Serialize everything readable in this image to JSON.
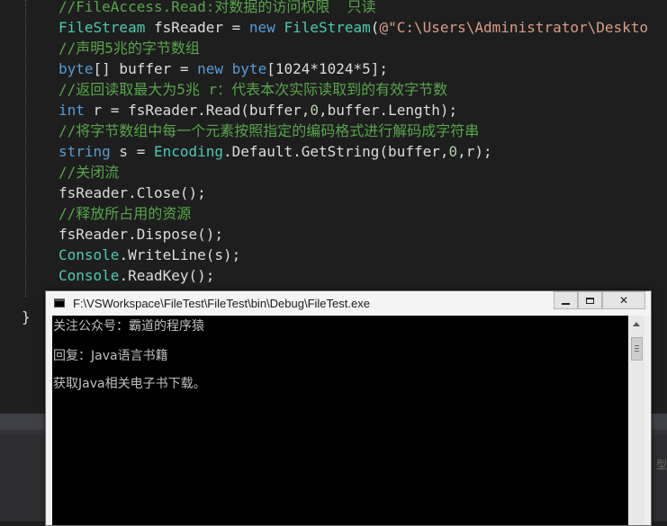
{
  "editor": {
    "lines": [
      [
        {
          "t": "//FileAccess.Read:对数据的访问权限  只读",
          "c": "cm"
        }
      ],
      [
        {
          "t": "FileStream",
          "c": "ty"
        },
        {
          "t": " fsReader = ",
          "c": ""
        },
        {
          "t": "new",
          "c": "kw"
        },
        {
          "t": " ",
          "c": ""
        },
        {
          "t": "FileStream",
          "c": "ty"
        },
        {
          "t": "(",
          "c": ""
        },
        {
          "t": "@\"C:\\Users\\Administrator\\Deskto",
          "c": "str"
        }
      ],
      [
        {
          "t": "//声明5兆的字节数组",
          "c": "cm"
        }
      ],
      [
        {
          "t": "byte",
          "c": "kw"
        },
        {
          "t": "[] buffer = ",
          "c": ""
        },
        {
          "t": "new",
          "c": "kw"
        },
        {
          "t": " ",
          "c": ""
        },
        {
          "t": "byte",
          "c": "kw"
        },
        {
          "t": "[1024*1024*5];",
          "c": ""
        }
      ],
      [
        {
          "t": "//返回读取最大为5兆 r：代表本次实际读取到的有效字节数",
          "c": "cm"
        }
      ],
      [
        {
          "t": "int",
          "c": "kw"
        },
        {
          "t": " r = fsReader.Read(buffer,",
          "c": ""
        },
        {
          "t": "0",
          "c": "num"
        },
        {
          "t": ",buffer.Length);",
          "c": ""
        }
      ],
      [
        {
          "t": "//将字节数组中每一个元素按照指定的编码格式进行解码成字符串",
          "c": "cm"
        }
      ],
      [
        {
          "t": "string",
          "c": "kw"
        },
        {
          "t": " s = ",
          "c": ""
        },
        {
          "t": "Encoding",
          "c": "ty"
        },
        {
          "t": ".Default.GetString(buffer,",
          "c": ""
        },
        {
          "t": "0",
          "c": "num"
        },
        {
          "t": ",r);",
          "c": ""
        }
      ],
      [
        {
          "t": "//关闭流",
          "c": "cm"
        }
      ],
      [
        {
          "t": "fsReader.Close();",
          "c": ""
        }
      ],
      [
        {
          "t": "//释放所占用的资源",
          "c": "cm"
        }
      ],
      [
        {
          "t": "fsReader.Dispose();",
          "c": ""
        }
      ],
      [
        {
          "t": "Console",
          "c": "ty"
        },
        {
          "t": ".WriteLine(s);",
          "c": ""
        }
      ],
      [
        {
          "t": "Console",
          "c": "ty"
        },
        {
          "t": ".ReadKey();",
          "c": ""
        }
      ]
    ],
    "closing_brace": "}"
  },
  "ide_panel": {
    "edge_text": "型"
  },
  "console_window": {
    "title": "F:\\VSWorkspace\\FileTest\\FileTest\\bin\\Debug\\FileTest.exe",
    "icon": "console-app-icon",
    "minimize_glyph": "minimize-icon",
    "maximize_glyph": "maximize-icon",
    "close_label": "✕",
    "output": [
      "关注公众号：霸道的程序猿",
      "回复：Java语言书籍",
      "获取Java相关电子书下载。"
    ]
  }
}
